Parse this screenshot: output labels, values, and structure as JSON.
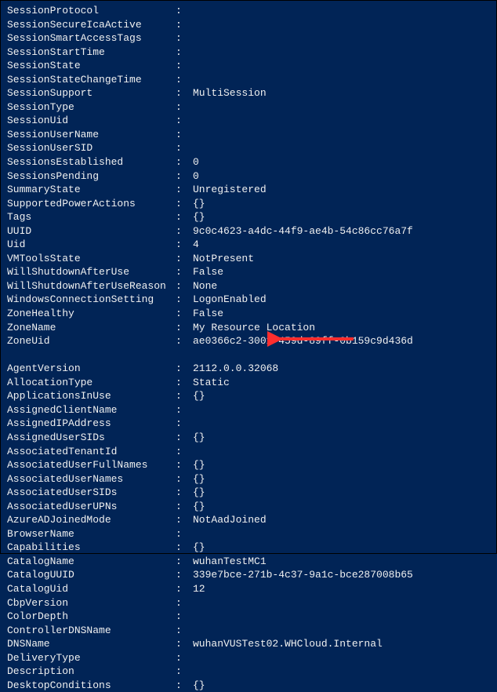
{
  "highlight": {
    "target_key": "AgentVersion",
    "arrow_color": "#ff2e2e"
  },
  "separator": ":",
  "groups": [
    {
      "rows": [
        {
          "key": "SessionProtocol",
          "value": ""
        },
        {
          "key": "SessionSecureIcaActive",
          "value": ""
        },
        {
          "key": "SessionSmartAccessTags",
          "value": ""
        },
        {
          "key": "SessionStartTime",
          "value": ""
        },
        {
          "key": "SessionState",
          "value": ""
        },
        {
          "key": "SessionStateChangeTime",
          "value": ""
        },
        {
          "key": "SessionSupport",
          "value": "MultiSession"
        },
        {
          "key": "SessionType",
          "value": ""
        },
        {
          "key": "SessionUid",
          "value": ""
        },
        {
          "key": "SessionUserName",
          "value": ""
        },
        {
          "key": "SessionUserSID",
          "value": ""
        },
        {
          "key": "SessionsEstablished",
          "value": "0"
        },
        {
          "key": "SessionsPending",
          "value": "0"
        },
        {
          "key": "SummaryState",
          "value": "Unregistered"
        },
        {
          "key": "SupportedPowerActions",
          "value": "{}"
        },
        {
          "key": "Tags",
          "value": "{}"
        },
        {
          "key": "UUID",
          "value": "9c0c4623-a4dc-44f9-ae4b-54c86cc76a7f"
        },
        {
          "key": "Uid",
          "value": "4"
        },
        {
          "key": "VMToolsState",
          "value": "NotPresent"
        },
        {
          "key": "WillShutdownAfterUse",
          "value": "False"
        },
        {
          "key": "WillShutdownAfterUseReason",
          "value": "None"
        },
        {
          "key": "WindowsConnectionSetting",
          "value": "LogonEnabled"
        },
        {
          "key": "ZoneHealthy",
          "value": "False"
        },
        {
          "key": "ZoneName",
          "value": "My Resource Location"
        },
        {
          "key": "ZoneUid",
          "value": "ae0366c2-3001-459d-89ff-0b159c9d436d"
        }
      ]
    },
    {
      "rows": [
        {
          "key": "AgentVersion",
          "value": "2112.0.0.32068"
        },
        {
          "key": "AllocationType",
          "value": "Static"
        },
        {
          "key": "ApplicationsInUse",
          "value": "{}"
        },
        {
          "key": "AssignedClientName",
          "value": ""
        },
        {
          "key": "AssignedIPAddress",
          "value": ""
        },
        {
          "key": "AssignedUserSIDs",
          "value": "{}"
        },
        {
          "key": "AssociatedTenantId",
          "value": ""
        },
        {
          "key": "AssociatedUserFullNames",
          "value": "{}"
        },
        {
          "key": "AssociatedUserNames",
          "value": "{}"
        },
        {
          "key": "AssociatedUserSIDs",
          "value": "{}"
        },
        {
          "key": "AssociatedUserUPNs",
          "value": "{}"
        },
        {
          "key": "AzureADJoinedMode",
          "value": "NotAadJoined"
        },
        {
          "key": "BrowserName",
          "value": ""
        },
        {
          "key": "Capabilities",
          "value": "{}"
        },
        {
          "key": "CatalogName",
          "value": "wuhanTestMC1"
        },
        {
          "key": "CatalogUUID",
          "value": "339e7bce-271b-4c37-9a1c-bce287008b65"
        },
        {
          "key": "CatalogUid",
          "value": "12"
        },
        {
          "key": "CbpVersion",
          "value": ""
        },
        {
          "key": "ColorDepth",
          "value": ""
        },
        {
          "key": "ControllerDNSName",
          "value": ""
        },
        {
          "key": "DNSName",
          "value": "wuhanVUSTest02.WHCloud.Internal"
        },
        {
          "key": "DeliveryType",
          "value": ""
        },
        {
          "key": "Description",
          "value": ""
        },
        {
          "key": "DesktopConditions",
          "value": "{}"
        }
      ]
    }
  ]
}
